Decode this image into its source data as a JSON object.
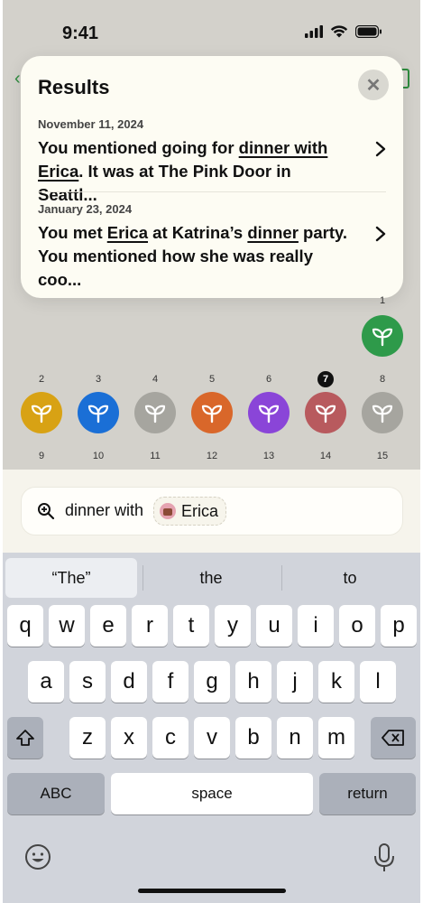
{
  "status_bar": {
    "time": "9:41"
  },
  "results": {
    "title": "Results",
    "close_label": "✕",
    "items": [
      {
        "date": "November 11, 2024",
        "parts": [
          "You mentioned going for ",
          "dinner with",
          " ",
          "Erica",
          ". It was at The Pink Door in Seattl..."
        ]
      },
      {
        "date": "January 23, 2024",
        "parts": [
          "You met ",
          "Erica",
          " at Katrina’s ",
          "dinner",
          " party. You mentioned how she was really coo..."
        ]
      }
    ]
  },
  "grid": {
    "row0": [
      {
        "label": "1",
        "color": "#2e9a4a"
      }
    ],
    "row1_numbers": [
      "2",
      "3",
      "4",
      "5",
      "6",
      "7",
      "8"
    ],
    "row1": [
      {
        "color": "#d8a214"
      },
      {
        "color": "#1a6fd6"
      },
      {
        "color": "#a6a59f"
      },
      {
        "color": "#d9672a"
      },
      {
        "color": "#8a45d8"
      },
      {
        "color": "#b85a5e"
      },
      {
        "color": "#a6a59f"
      }
    ],
    "row2_numbers": [
      "9",
      "10",
      "11",
      "12",
      "13",
      "14",
      "15"
    ],
    "selected_number": "7"
  },
  "search": {
    "query": "dinner with",
    "chip_name": "Erica"
  },
  "keyboard": {
    "suggestions": [
      "“The”",
      "the",
      "to"
    ],
    "row1": [
      "q",
      "w",
      "e",
      "r",
      "t",
      "y",
      "u",
      "i",
      "o",
      "p"
    ],
    "row2": [
      "a",
      "s",
      "d",
      "f",
      "g",
      "h",
      "j",
      "k",
      "l"
    ],
    "row3": [
      "z",
      "x",
      "c",
      "v",
      "b",
      "n",
      "m"
    ],
    "abc_label": "ABC",
    "space_label": "space",
    "return_label": "return"
  }
}
